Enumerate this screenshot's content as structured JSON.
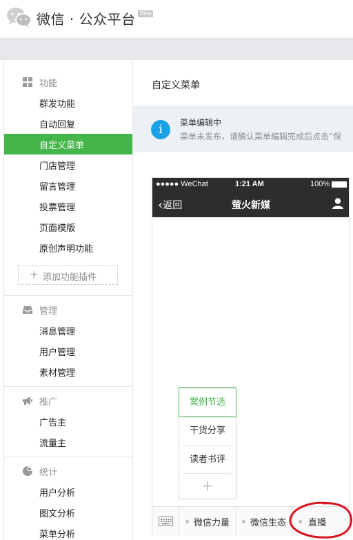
{
  "header": {
    "brand": "微信 · 公众平台",
    "beta": "Beta"
  },
  "sidebar": {
    "groups": [
      {
        "title": "功能",
        "icon": "grid-icon",
        "items": [
          "群发功能",
          "自动回复",
          "自定义菜单",
          "门店管理",
          "留言管理",
          "投票管理",
          "页面模版",
          "原创声明功能"
        ]
      },
      {
        "title": "管理",
        "icon": "inbox-icon",
        "items": [
          "消息管理",
          "用户管理",
          "素材管理"
        ]
      },
      {
        "title": "推广",
        "icon": "megaphone-icon",
        "items": [
          "广告主",
          "流量主"
        ]
      },
      {
        "title": "统计",
        "icon": "pie-chart-icon",
        "items": [
          "用户分析",
          "图文分析",
          "菜单分析"
        ]
      }
    ],
    "active_item": "自定义菜单",
    "add_plugin_label": "添加功能插件"
  },
  "main": {
    "page_title": "自定义菜单",
    "notice": {
      "icon": "i",
      "title": "菜单编辑中",
      "desc": "菜单未发布，请确认菜单编辑完成后点击“保"
    }
  },
  "phone": {
    "status": {
      "carrier": "●●●●● WeChat",
      "time": "1:21 AM",
      "battery": "100%"
    },
    "nav": {
      "back_label": "返回",
      "account_name": "萤火新媒"
    },
    "submenu": {
      "items": [
        "案例节选",
        "干货分享",
        "读者书评"
      ],
      "selected": "案例节选",
      "add_symbol": "+"
    },
    "menu_buttons": [
      "微信力量",
      "微信生态",
      "直播"
    ]
  },
  "colors": {
    "accent_green": "#44b549",
    "info_blue": "#1aa1e6",
    "phone_bar": "#2d2d2d",
    "annotation_red": "#d9121e"
  }
}
